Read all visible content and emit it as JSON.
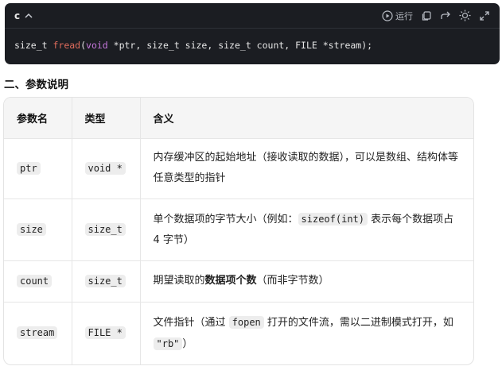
{
  "code_block": {
    "language": "c",
    "run_label": "运行",
    "tokens": [
      "size_t ",
      "fread",
      "(",
      "void",
      " *ptr, size_t size, size_t count, FILE *stream);"
    ]
  },
  "section_title": "二、参数说明",
  "table": {
    "headers": [
      "参数名",
      "类型",
      "含义"
    ],
    "rows": [
      {
        "name": "ptr",
        "type": "void *",
        "desc": [
          "内存缓冲区的起始地址（接收读取的数据），可以是数组、结构体等任意类型的指针"
        ]
      },
      {
        "name": "size",
        "type": "size_t",
        "desc": [
          "单个数据项的字节大小（例如：",
          "sizeof(int)",
          " 表示每个数据项占 4 字节）"
        ]
      },
      {
        "name": "count",
        "type": "size_t",
        "desc": [
          "期望读取的",
          "数据项个数",
          "（而非字节数）"
        ]
      },
      {
        "name": "stream",
        "type": "FILE *",
        "desc": [
          "文件指针（通过 ",
          "fopen",
          " 打开的文件流，需以二进制模式打开，如 ",
          "\"rb\"",
          "）"
        ]
      }
    ]
  }
}
